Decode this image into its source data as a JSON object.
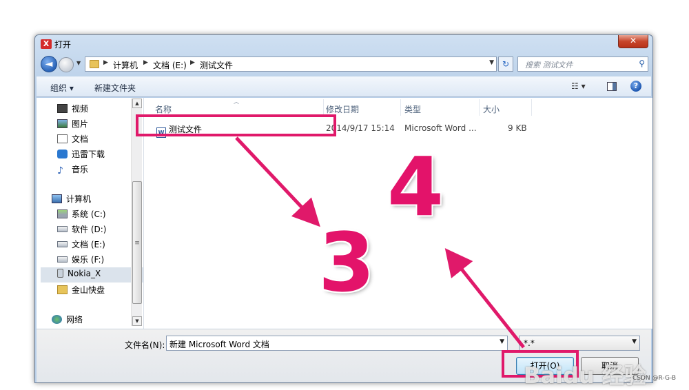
{
  "window": {
    "title": "打开",
    "app_icon": "X",
    "close_label": "✕"
  },
  "nav": {
    "back_icon": "arrow-left-icon",
    "forward_icon": "arrow-right-icon"
  },
  "address": {
    "crumbs": [
      "计算机",
      "文档 (E:)",
      "测试文件"
    ]
  },
  "search": {
    "placeholder": "搜索 测试文件"
  },
  "toolbar": {
    "organize": "组织 ▾",
    "new_folder": "新建文件夹"
  },
  "sidebar": {
    "items": [
      {
        "label": "视频",
        "icon": "video-icon"
      },
      {
        "label": "图片",
        "icon": "picture-icon"
      },
      {
        "label": "文档",
        "icon": "document-icon"
      },
      {
        "label": "迅雷下载",
        "icon": "download-icon"
      },
      {
        "label": "音乐",
        "icon": "music-icon"
      },
      {
        "label": "计算机",
        "icon": "computer-icon"
      },
      {
        "label": "系统 (C:)",
        "icon": "system-drive-icon"
      },
      {
        "label": "软件 (D:)",
        "icon": "drive-icon"
      },
      {
        "label": "文档 (E:)",
        "icon": "drive-icon",
        "selected": true
      },
      {
        "label": "娱乐 (F:)",
        "icon": "drive-icon"
      },
      {
        "label": "Nokia_X",
        "icon": "phone-icon"
      },
      {
        "label": "金山快盘",
        "icon": "folder-icon"
      },
      {
        "label": "网络",
        "icon": "network-icon"
      }
    ]
  },
  "columns": {
    "name": "名称",
    "modified": "修改日期",
    "type": "类型",
    "size": "大小"
  },
  "files": [
    {
      "name": "测试文件",
      "modified": "2014/9/17 15:14",
      "type": "Microsoft Word ...",
      "size": "9 KB",
      "icon": "word-document-icon"
    }
  ],
  "footer": {
    "filename_label": "文件名(N):",
    "filename_value": "新建 Microsoft Word 文档",
    "filetype_value": "*.*",
    "open_label": "打开(O)",
    "cancel_label": "取消"
  },
  "annotations": {
    "step3": "3",
    "step4": "4",
    "accent": "#e0196a"
  },
  "watermark": {
    "brand": "Baidu 经验",
    "credit": "CSDN @R-G-B"
  }
}
